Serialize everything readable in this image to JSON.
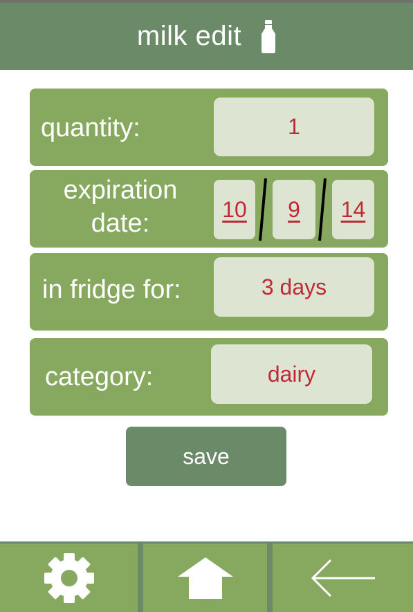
{
  "header": {
    "title": "milk edit",
    "icon": "milk-bottle-icon"
  },
  "fields": {
    "quantity": {
      "label": "quantity:",
      "value": "1"
    },
    "expiration": {
      "label_line1": "expiration",
      "label_line2": "date:",
      "month": "10",
      "day": "9",
      "year": "14"
    },
    "fridge": {
      "label": "in fridge for:",
      "value": "3 days"
    },
    "category": {
      "label": "category:",
      "value": "dairy"
    }
  },
  "actions": {
    "save_label": "save"
  },
  "nav": {
    "settings_icon": "gear-icon",
    "home_icon": "home-icon",
    "back_icon": "back-arrow-icon"
  },
  "colors": {
    "header": "#6b8a67",
    "card": "#86a85f",
    "field": "#dde5d2",
    "value_text": "#c02837",
    "label_text": "#ffffff"
  }
}
